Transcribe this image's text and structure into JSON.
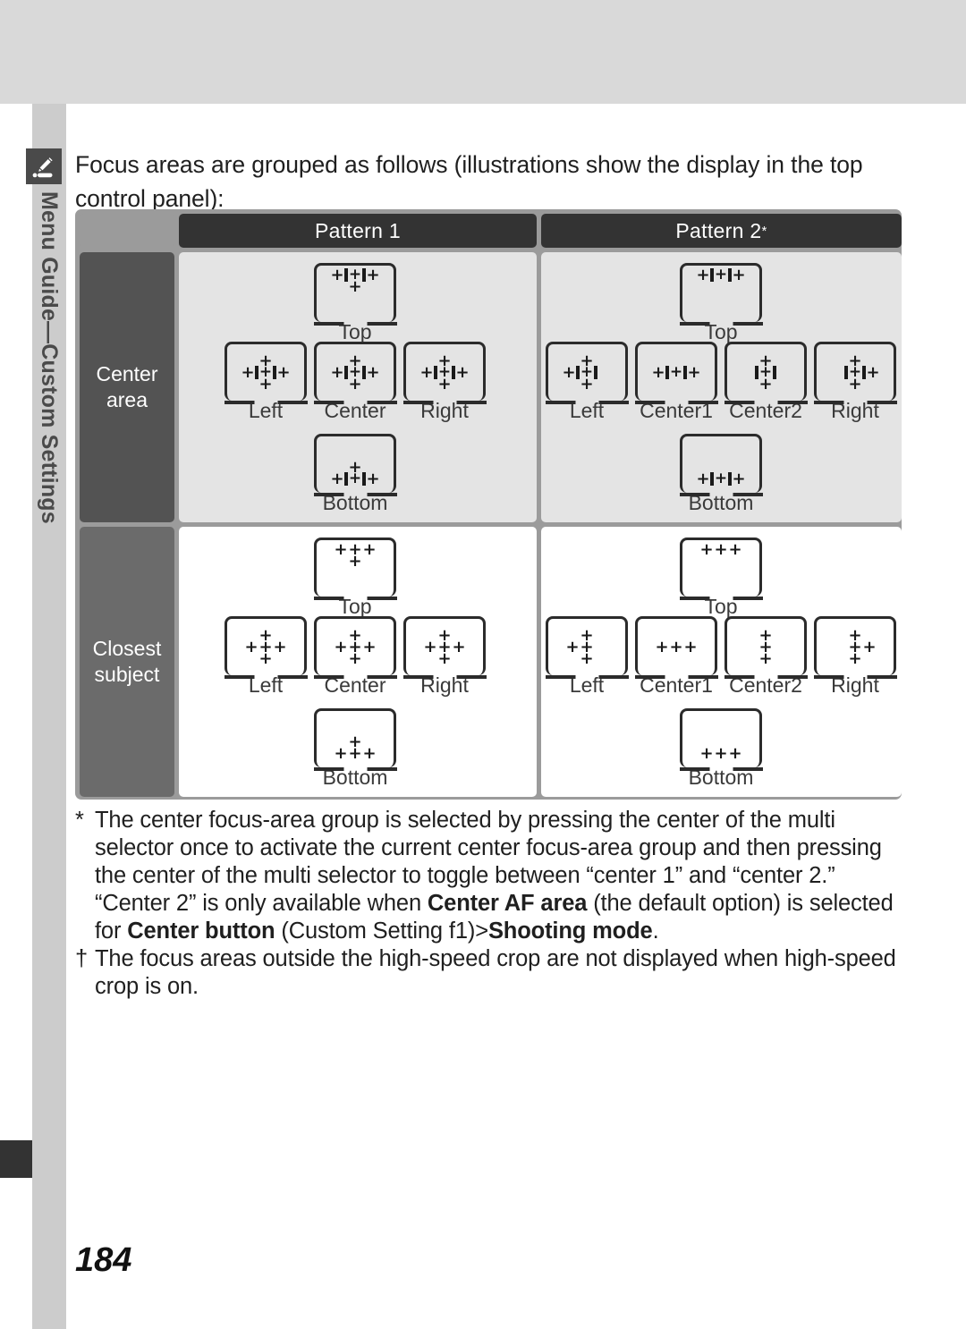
{
  "page": {
    "number": "184",
    "sidebar_label": "Menu Guide—Custom Settings",
    "sidebar_icon": "pencil-note-icon"
  },
  "intro": "Focus areas are grouped as follows (illustrations show the display in the top control panel):",
  "table": {
    "headers": {
      "blank": "",
      "pattern1": "Pattern 1",
      "pattern2": "Pattern 2",
      "pattern2_marker": "*"
    },
    "rows": [
      {
        "label": "Center area",
        "label_line1": "Center",
        "label_line2": "area",
        "pattern1": {
          "top": {
            "caption": "Top"
          },
          "left": {
            "caption": "Left"
          },
          "center": {
            "caption": "Center"
          },
          "right": {
            "caption": "Right"
          },
          "bottom": {
            "caption": "Bottom"
          }
        },
        "pattern2": {
          "top": {
            "caption": "Top"
          },
          "left": {
            "caption": "Left"
          },
          "center1": {
            "caption": "Center1"
          },
          "center2": {
            "caption": "Center2"
          },
          "right": {
            "caption": "Right"
          },
          "bottom": {
            "caption": "Bottom"
          }
        }
      },
      {
        "label": "Closest subject",
        "label_line1": "Closest",
        "label_line2": "subject",
        "pattern1": {
          "top": {
            "caption": "Top"
          },
          "left": {
            "caption": "Left"
          },
          "center": {
            "caption": "Center"
          },
          "right": {
            "caption": "Right"
          },
          "bottom": {
            "caption": "Bottom"
          }
        },
        "pattern2": {
          "top": {
            "caption": "Top"
          },
          "left": {
            "caption": "Left"
          },
          "center1": {
            "caption": "Center1"
          },
          "center2": {
            "caption": "Center2"
          },
          "right": {
            "caption": "Right"
          },
          "bottom": {
            "caption": "Bottom"
          }
        }
      }
    ]
  },
  "notes": {
    "asterisk_symbol": "*",
    "asterisk_part1": "The center focus-area group is selected by pressing the center of the multi selector once to activate the current center focus-area group and then pressing the center of the multi selector to toggle between “center 1” and “center 2.”  “Center 2” is only available when ",
    "asterisk_bold1": "Center AF area",
    "asterisk_part2": " (the default option) is selected for ",
    "asterisk_bold2": "Center button",
    "asterisk_part3": " (Custom Setting f1)>",
    "asterisk_bold3": "Shooting mode",
    "asterisk_part4": ".",
    "dagger_symbol": "†",
    "dagger_text": "The focus areas outside the high-speed crop are not displayed when high-speed crop is on."
  },
  "colors": {
    "top_band": "#d9d9d9",
    "sidebar": "#cccccc",
    "sidebar_tab": "#4a4a4a",
    "table_frame": "#9b9b9b",
    "header_cell": "#333333",
    "label_cell_center": "#535353",
    "label_cell_closest": "#6b6b6b",
    "panel_grey": "#e4e4e4",
    "panel_white": "#ffffff",
    "ink": "#1a1a1a"
  }
}
